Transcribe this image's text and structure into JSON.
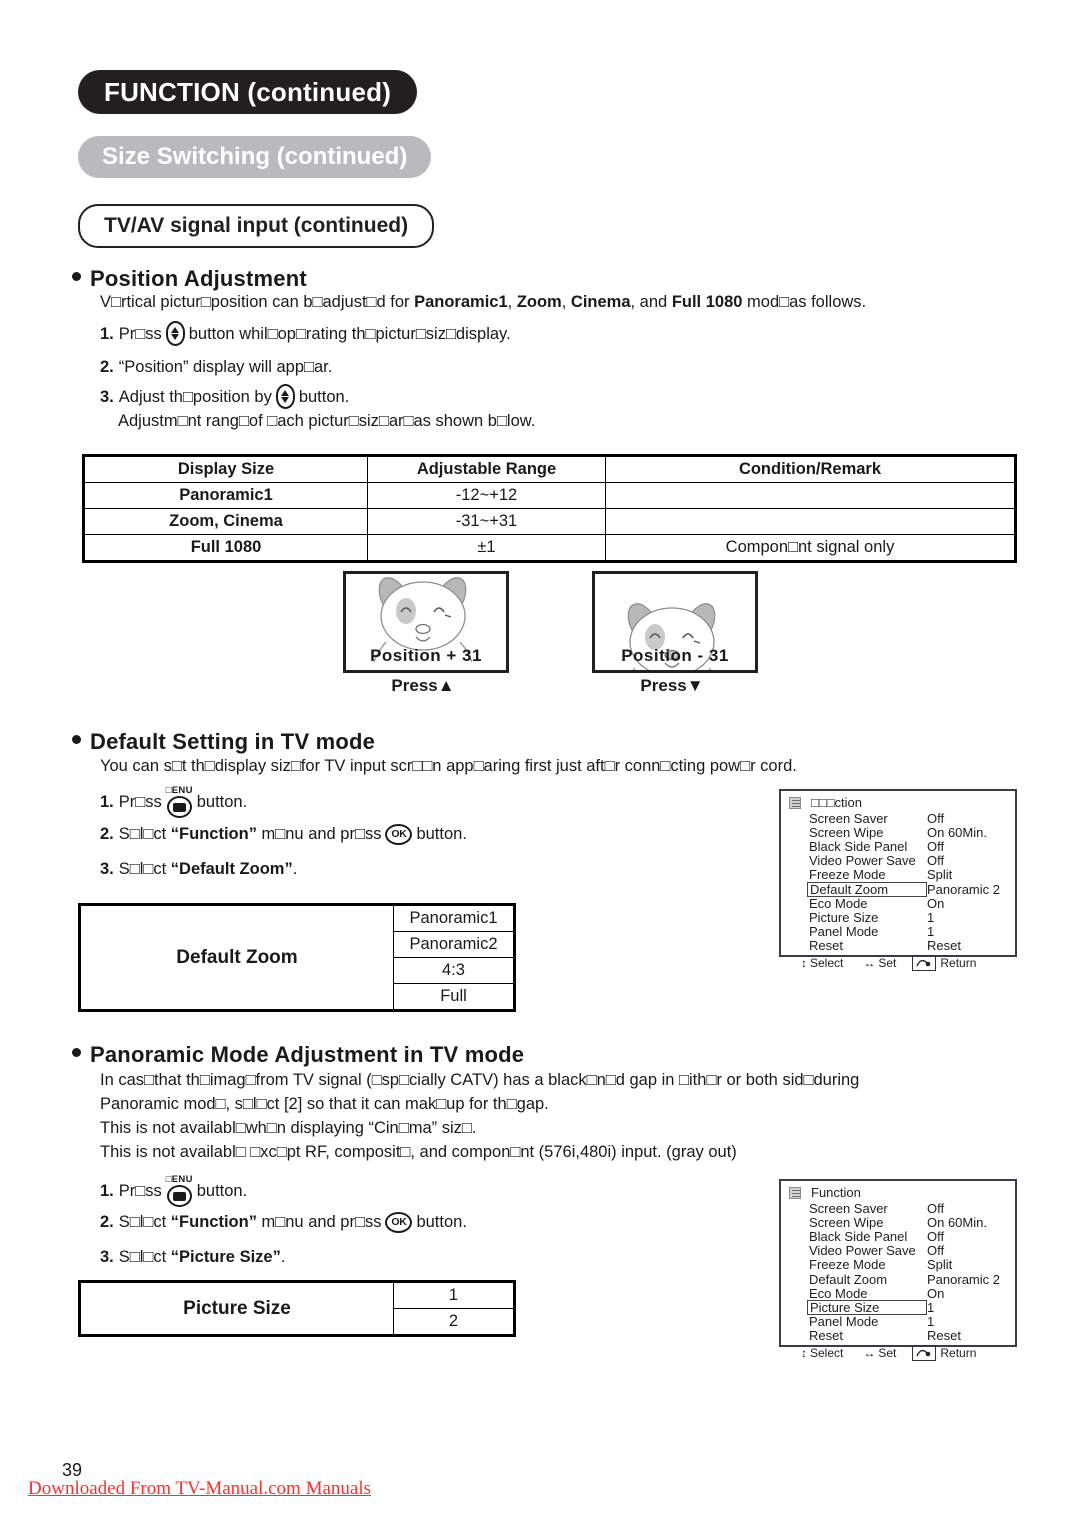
{
  "header": {
    "title_main": "FUNCTION (continued)",
    "title_sub": "Size Switching (continued)",
    "title_section": "TV/AV signal input (continued)"
  },
  "position_adjustment": {
    "heading": "Position Adjustment",
    "intro_pre": "V□rtical pictur□position can b□adjust□d for ",
    "intro_b1": "Panoramic1",
    "intro_mid1": ", ",
    "intro_b2": "Zoom",
    "intro_mid2": ", ",
    "intro_b3": "Cinema",
    "intro_mid3": ", and ",
    "intro_b4": "Full 1080",
    "intro_post": " mod□as follows.",
    "step1_num": "1.",
    "step1_a": "Pr□ss",
    "step1_b": "button whil□op□rating th□pictur□siz□display.",
    "step2_num": "2.",
    "step2_text": "“Position” display will app□ar.",
    "step3_num": "3.",
    "step3_a": "Adjust th□position by",
    "step3_b": "button.",
    "step3_note": "Adjustm□nt rang□of □ach pictur□siz□ar□as shown b□low."
  },
  "range_table": {
    "headers": [
      "Display Size",
      "Adjustable Range",
      "Condition/Remark"
    ],
    "rows": [
      [
        "Panoramic1",
        "-12~+12",
        ""
      ],
      [
        "Zoom, Cinema",
        "-31~+31",
        ""
      ],
      [
        "Full 1080",
        "±1",
        "Compon□nt signal only"
      ]
    ]
  },
  "previews": [
    {
      "caption": "Position  + 31",
      "press": "Press▲"
    },
    {
      "caption": "Position  - 31",
      "press": "Press▼"
    }
  ],
  "default_setting": {
    "heading": "Default Setting in TV mode",
    "intro": "You can s□t th□display siz□for TV input scr□□n app□aring first just aft□r conn□cting pow□r cord.",
    "step1_num": "1.",
    "step1_a": "Pr□ss",
    "step1_btn_label": "□ENU",
    "step1_b": "button.",
    "step2_num": "2.",
    "step2_a": "S□l□ct",
    "step2_bold": "“Function”",
    "step2_b": "m□nu and pr□ss",
    "step2_btn": "OK",
    "step2_c": "button.",
    "step3_num": "3.",
    "step3_a": "S□l□ct",
    "step3_bold": "“Default Zoom”",
    "step3_b": "."
  },
  "default_zoom_table": {
    "label": "Default Zoom",
    "options": [
      "Panoramic1",
      "Panoramic2",
      "4:3",
      "Full"
    ]
  },
  "panoramic_mode": {
    "heading": "Panoramic Mode Adjustment in TV mode",
    "line1": "In cas□that th□imag□from TV signal (□sp□cially CATV) has a black□n□d gap in □ith□r or both sid□during",
    "line2": "Panoramic mod□, s□l□ct [2] so that it can mak□up for th□gap.",
    "line3": "This is not availabl□wh□n displaying “Cin□ma” siz□.",
    "line4": "This is not availabl□ □xc□pt RF, composit□, and compon□nt (576i,480i) input. (gray out)",
    "step1_num": "1.",
    "step1_a": "Pr□ss",
    "step1_btn_label": "□ENU",
    "step1_b": "button.",
    "step2_num": "2.",
    "step2_a": "S□l□ct",
    "step2_bold": "“Function”",
    "step2_b": "m□nu and pr□ss",
    "step2_btn": "OK",
    "step2_c": "button.",
    "step3_num": "3.",
    "step3_a": "S□l□ct",
    "step3_bold": "“Picture Size”",
    "step3_b": "."
  },
  "picture_size_table": {
    "label": "Picture Size",
    "options": [
      "1",
      "2"
    ]
  },
  "osd_menu_1": {
    "title": "□□□ction",
    "rows": [
      {
        "key": "Screen Saver",
        "value": "Off",
        "selected": false
      },
      {
        "key": "Screen Wipe",
        "value": "On 60Min.",
        "selected": false
      },
      {
        "key": "Black Side Panel",
        "value": "Off",
        "selected": false
      },
      {
        "key": "Video Power Save",
        "value": "Off",
        "selected": false
      },
      {
        "key": "Freeze Mode",
        "value": "Split",
        "selected": false
      },
      {
        "key": "Default Zoom",
        "value": "Panoramic 2",
        "selected": true
      },
      {
        "key": "Eco Mode",
        "value": "On",
        "selected": false
      },
      {
        "key": "Picture Size",
        "value": "1",
        "selected": false
      },
      {
        "key": "Panel Mode",
        "value": "1",
        "selected": false
      },
      {
        "key": "Reset",
        "value": "Reset",
        "selected": false
      }
    ],
    "footer": {
      "select": "Select",
      "set": "Set",
      "return": "Return"
    }
  },
  "osd_menu_2": {
    "title": "Function",
    "rows": [
      {
        "key": "Screen Saver",
        "value": "Off",
        "selected": false
      },
      {
        "key": "Screen Wipe",
        "value": "On 60Min.",
        "selected": false
      },
      {
        "key": "Black Side Panel",
        "value": "Off",
        "selected": false
      },
      {
        "key": "Video Power Save",
        "value": "Off",
        "selected": false
      },
      {
        "key": "Freeze Mode",
        "value": "Split",
        "selected": false
      },
      {
        "key": "Default Zoom",
        "value": "Panoramic 2",
        "selected": false
      },
      {
        "key": "Eco Mode",
        "value": "On",
        "selected": false
      },
      {
        "key": "Picture Size",
        "value": "1",
        "selected": true
      },
      {
        "key": "Panel Mode",
        "value": "1",
        "selected": false
      },
      {
        "key": "Reset",
        "value": "Reset",
        "selected": false
      }
    ],
    "footer": {
      "select": "Select",
      "set": "Set",
      "return": "Return"
    }
  },
  "footer": {
    "page_number": "39",
    "download_note": "Downloaded From TV-Manual.com Manuals"
  }
}
